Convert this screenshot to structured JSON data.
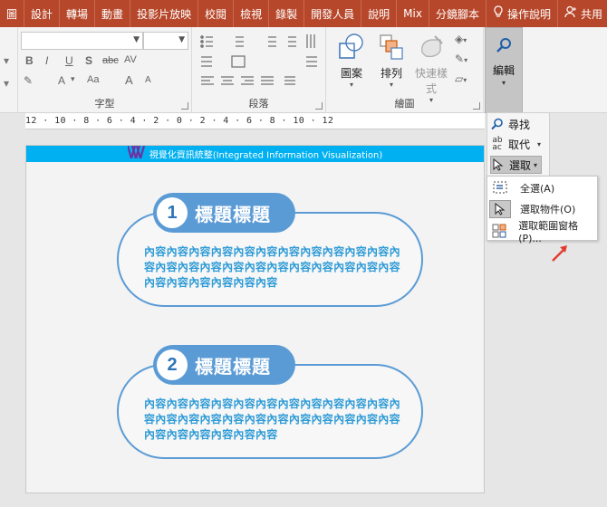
{
  "tabs": [
    {
      "label": "圖"
    },
    {
      "label": "設計"
    },
    {
      "label": "轉場"
    },
    {
      "label": "動畫"
    },
    {
      "label": "投影片放映"
    },
    {
      "label": "校閱"
    },
    {
      "label": "檢視"
    },
    {
      "label": "錄製"
    },
    {
      "label": "開發人員"
    },
    {
      "label": "說明"
    },
    {
      "label": "Mix"
    },
    {
      "label": "分鏡腳本"
    }
  ],
  "tell_me": "操作說明",
  "share": "共用",
  "ribbon": {
    "font_group_label": "字型",
    "paragraph_group_label": "段落",
    "drawing_group_label": "繪圖",
    "font_buttons": {
      "bold": "B",
      "italic": "I",
      "underline": "U",
      "shadow": "S",
      "strike": "abc",
      "spacing": "AV",
      "case": "Aa",
      "font_color": "A",
      "grow": "A",
      "shrink": "A"
    },
    "shapes_label": "圖案",
    "arrange_label": "排列",
    "quick_styles_label": "快速樣式",
    "editing_label": "編輯"
  },
  "ruler_text": "12 · 10 · 8 · 6 · 4 · 2 · 0 · 2 · 4 · 6 · 8 · 10 · 12",
  "edit_menu": {
    "find": "尋找",
    "replace": "取代",
    "select": "選取"
  },
  "select_submenu": [
    {
      "label": "全選(A)"
    },
    {
      "label": "選取物件(O)"
    },
    {
      "label": "選取範圍窗格(P)..."
    }
  ],
  "slide": {
    "header": "視覺化資訊統整(Integrated Information Visualization)",
    "cards": [
      {
        "number": "1",
        "title": "標題標題",
        "body": "內容內容內容內容內容內容內容內容內容內容內容內容內容內容內容內容內容內容內容內容內容內容內容內容內容內容內容內容內容"
      },
      {
        "number": "2",
        "title": "標題標題",
        "body": "內容內容內容內容內容內容內容內容內容內容內容內容內容內容內容內容內容內容內容內容內容內容內容內容內容內容內容內容內容"
      }
    ]
  },
  "colors": {
    "tab_bar": "#b7472a",
    "slide_header": "#00b0f0",
    "pill": "#5b9bd5",
    "body_text": "#2e9bd6"
  }
}
